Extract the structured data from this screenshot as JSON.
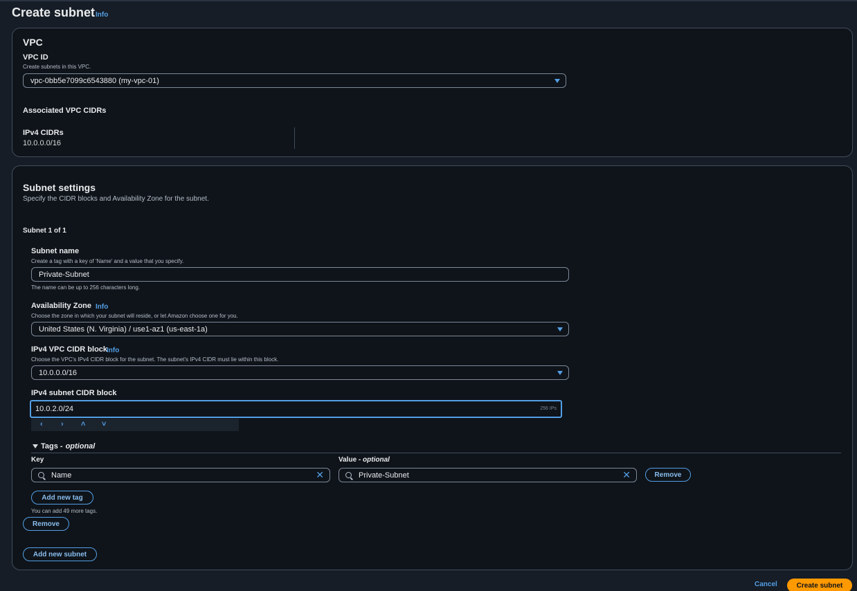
{
  "header": {
    "title": "Create subnet",
    "info": "Info"
  },
  "vpc": {
    "heading": "VPC",
    "vpc_id_label": "VPC ID",
    "vpc_id_desc": "Create subnets in this VPC.",
    "vpc_id_value": "vpc-0bb5e7099c6543880 (my-vpc-01)",
    "assoc_heading": "Associated VPC CIDRs",
    "ipv4_label": "IPv4 CIDRs",
    "ipv4_value": "10.0.0.0/16"
  },
  "subnet_settings": {
    "heading": "Subnet settings",
    "desc": "Specify the CIDR blocks and Availability Zone for the subnet.",
    "counter": "Subnet 1 of 1",
    "name_label": "Subnet name",
    "name_desc": "Create a tag with a key of 'Name' and a value that you specify.",
    "name_value": "Private-Subnet",
    "name_hint": "The name can be up to 256 characters long.",
    "az_label": "Availability Zone",
    "az_info": "Info",
    "az_desc": "Choose the zone in which your subnet will reside, or let Amazon choose one for you.",
    "az_value": "United States (N. Virginia) / use1-az1 (us-east-1a)",
    "vpc_cidr_label": "IPv4 VPC CIDR block",
    "vpc_cidr_info": "Info",
    "vpc_cidr_desc": "Choose the VPC's IPv4 CIDR block for the subnet. The subnet's IPv4 CIDR must lie within this block.",
    "vpc_cidr_value": "10.0.0.0/16",
    "subnet_cidr_label": "IPv4 subnet CIDR block",
    "subnet_cidr_value": "10.0.2.0/24",
    "subnet_cidr_ips": "256 IPs",
    "stepper": {
      "left": "‹",
      "right": "›",
      "up": "˄",
      "down": "˅"
    }
  },
  "tags": {
    "toggle_label": "Tags -",
    "optional": "optional",
    "key_label": "Key",
    "value_label": "Value -",
    "value_optional": "optional",
    "key_value": "Name",
    "value_value": "Private-Subnet",
    "remove_tag": "Remove",
    "add_new_tag": "Add new tag",
    "limit_hint": "You can add 49 more tags.",
    "remove_subnet": "Remove",
    "add_new_subnet": "Add new subnet"
  },
  "footer": {
    "cancel": "Cancel",
    "create": "Create subnet"
  },
  "colors": {
    "accent": "#539fe5",
    "primary": "#ff9900",
    "bg": "#0f141a"
  }
}
